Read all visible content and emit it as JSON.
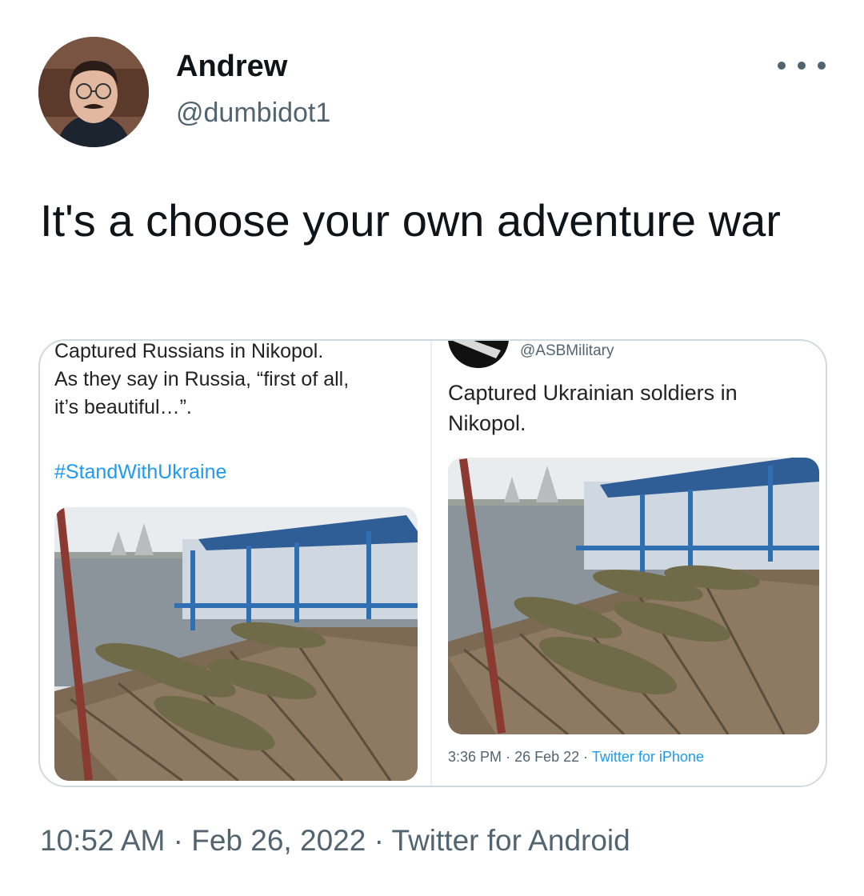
{
  "author": {
    "name": "Andrew",
    "handle": "@dumbidot1"
  },
  "tweet": {
    "text": "It's a choose your own adventure war",
    "timestamp": "10:52 AM",
    "date": "Feb 26, 2022",
    "separator": "·",
    "source": "Twitter for Android"
  },
  "media": {
    "left": {
      "line1": "Captured Russians in Nikopol.",
      "line2": "As they say in Russia, “first of all,",
      "line3": "it’s beautiful…”.",
      "hashtag": "#StandWithUkraine"
    },
    "right": {
      "handle": "@ASBMilitary",
      "text": "Captured Ukrainian soldiers in Nikopol.",
      "time": "3:36 PM",
      "date": "26 Feb 22",
      "separator": "·",
      "source": "Twitter for iPhone"
    }
  },
  "colors": {
    "link": "#1d9bf0",
    "secondary_text": "#536471",
    "border": "#cfd9de"
  },
  "icons": {
    "more": "more-horizontal-icon"
  }
}
